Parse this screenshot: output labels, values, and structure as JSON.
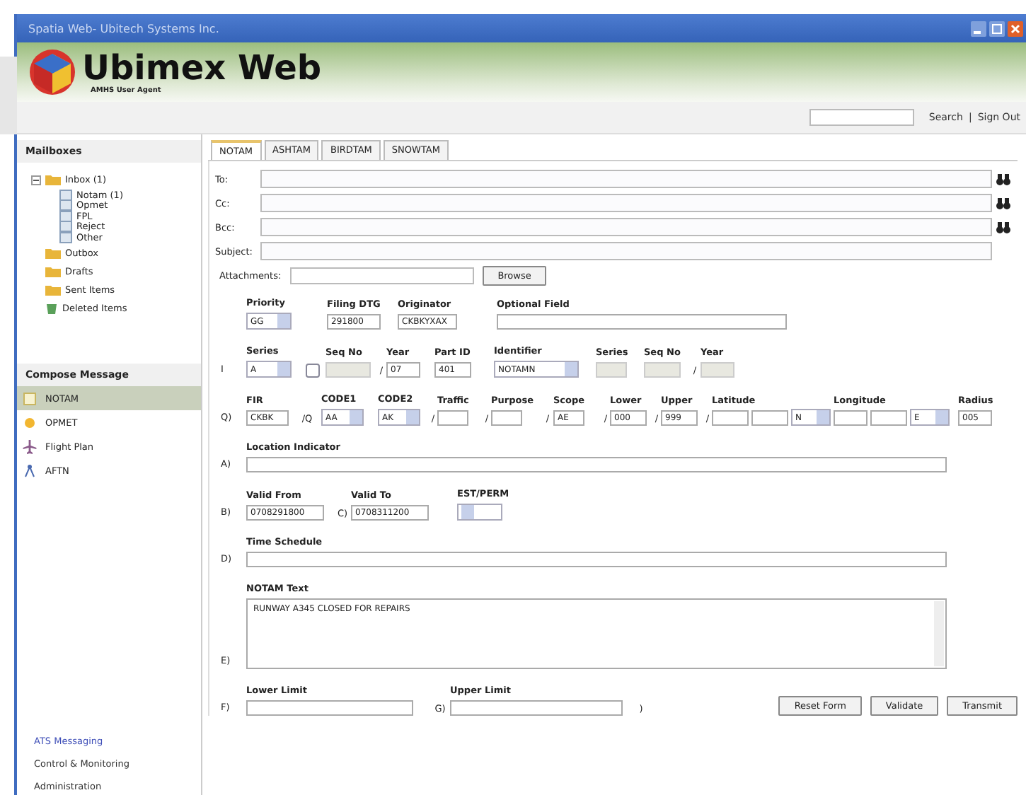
{
  "window": {
    "title": "Spatia Web- Ubitech Systems Inc."
  },
  "header": {
    "title": "Ubimex Web",
    "subtitle": "AMHS User Agent"
  },
  "top_links": [
    "Search",
    "|",
    "Sign Out"
  ],
  "sidebar": {
    "mailboxes_title": "Mailboxes",
    "tree": [
      {
        "label": "Inbox (1)",
        "kind": "folder",
        "expanded": true,
        "children": [
          {
            "label": "Notam (1)",
            "kind": "subfolder"
          },
          {
            "label": "Opmet",
            "kind": "subfolder"
          },
          {
            "label": "FPL",
            "kind": "subfolder"
          },
          {
            "label": "Reject",
            "kind": "subfolder"
          },
          {
            "label": "Other",
            "kind": "subfolder"
          }
        ]
      },
      {
        "label": "Outbox",
        "kind": "folder"
      },
      {
        "label": "Drafts",
        "kind": "folder"
      },
      {
        "label": "Sent Items",
        "kind": "folder"
      },
      {
        "label": "Deleted Items",
        "kind": "trash"
      }
    ],
    "compose_title": "Compose Message",
    "compose": [
      {
        "label": "NOTAM",
        "kind": "notam",
        "selected": true
      },
      {
        "label": "OPMET",
        "kind": "opmet",
        "selected": false
      },
      {
        "label": "Flight Plan",
        "kind": "plane",
        "selected": false
      },
      {
        "label": "AFTN",
        "kind": "aftn",
        "selected": false
      }
    ],
    "nav": [
      {
        "label": "ATS Messaging",
        "selected": true
      },
      {
        "label": "Control & Monitoring",
        "selected": false
      },
      {
        "label": "Administration",
        "selected": false
      }
    ]
  },
  "tabs": [
    {
      "label": "NOTAM",
      "selected": true
    },
    {
      "label": "ASHTAM",
      "selected": false
    },
    {
      "label": "BIRDTAM",
      "selected": false
    },
    {
      "label": "SNOWTAM",
      "selected": false
    }
  ],
  "address": [
    {
      "label": "To:",
      "lookup": true
    },
    {
      "label": "Cc:",
      "lookup": true
    },
    {
      "label": "Bcc:",
      "lookup": true
    },
    {
      "label": "Subject:",
      "lookup": false
    }
  ],
  "attachments": {
    "label": "Attachments:",
    "button": "Browse"
  },
  "rows": [
    {
      "items": [
        {
          "kind": "select",
          "label": "Priority",
          "value": "GG"
        },
        {
          "kind": "text",
          "label": "Filing DTG",
          "value": "291800",
          "disabled": false
        },
        {
          "kind": "text",
          "label": "Originator",
          "value": "CKBKYXAX",
          "disabled": false
        },
        {
          "kind": "text",
          "label": "Optional Field",
          "disabled": false
        }
      ]
    },
    {
      "prefix": "I",
      "items": [
        {
          "kind": "select",
          "label": "Series",
          "value": "A"
        },
        {
          "kind": "checkbox",
          "checked": false
        },
        {
          "kind": "text",
          "label": "Seq No",
          "disabled": true
        },
        {
          "kind": "sep",
          "text": "/"
        },
        {
          "kind": "text",
          "label": "Year",
          "value": "07",
          "disabled": false
        },
        {
          "kind": "text",
          "label": "Part ID",
          "value": "401",
          "disabled": false
        },
        {
          "kind": "select",
          "label": "Identifier",
          "value": "NOTAMN"
        },
        {
          "kind": "text",
          "label": "Series",
          "disabled": true
        },
        {
          "kind": "text",
          "label": "Seq No",
          "disabled": true
        },
        {
          "kind": "sep",
          "text": "/"
        },
        {
          "kind": "text",
          "label": "Year",
          "disabled": true
        }
      ]
    },
    {
      "prefix": "Q)",
      "items": [
        {
          "kind": "text",
          "label": "FIR",
          "value": "CKBK",
          "disabled": false
        },
        {
          "kind": "sep",
          "text": "/Q"
        },
        {
          "kind": "select",
          "label": "CODE1",
          "value": "AA"
        },
        {
          "kind": "select",
          "label": "CODE2",
          "value": "AK"
        },
        {
          "kind": "sep",
          "text": "/"
        },
        {
          "kind": "text",
          "label": "Traffic",
          "disabled": false
        },
        {
          "kind": "sep",
          "text": "/"
        },
        {
          "kind": "text",
          "label": "Purpose",
          "disabled": false
        },
        {
          "kind": "sep",
          "text": "/"
        },
        {
          "kind": "text",
          "label": "Scope",
          "value": "AE",
          "disabled": false
        },
        {
          "kind": "sep",
          "text": "/"
        },
        {
          "kind": "text",
          "label": "Lower",
          "value": "000",
          "disabled": false
        },
        {
          "kind": "sep",
          "text": "/"
        },
        {
          "kind": "text",
          "label": "Upper",
          "value": "999",
          "disabled": false
        },
        {
          "kind": "sep",
          "text": "/"
        },
        {
          "kind": "text",
          "label": "Latitude",
          "disabled": false
        },
        {
          "kind": "text",
          "disabled": false
        },
        {
          "kind": "select",
          "value": "N"
        },
        {
          "kind": "text",
          "label": "Longitude",
          "disabled": false
        },
        {
          "kind": "text",
          "disabled": false
        },
        {
          "kind": "select",
          "value": "E"
        },
        {
          "kind": "text",
          "label": "Radius",
          "value": "005",
          "disabled": false
        }
      ]
    },
    {
      "prefix": "A)",
      "items": [
        {
          "kind": "text",
          "label": "Location Indicator",
          "disabled": false
        }
      ]
    },
    {
      "prefix": "B)",
      "items": [
        {
          "kind": "text",
          "label": "Valid From",
          "value": "0708291800",
          "disabled": false
        },
        {
          "kind": "prefix",
          "text": "C)"
        },
        {
          "kind": "text",
          "label": "Valid To",
          "value": "0708311200",
          "disabled": false
        },
        {
          "kind": "select",
          "label": "EST/PERM"
        }
      ]
    },
    {
      "prefix": "D)",
      "items": [
        {
          "kind": "text",
          "label": "Time Schedule",
          "disabled": false
        }
      ]
    },
    {
      "prefix": "E)",
      "items": [
        {
          "kind": "textarea",
          "label": "NOTAM Text",
          "value": "RUNWAY A345 CLOSED FOR REPAIRS"
        }
      ]
    },
    {
      "prefix": "F)",
      "items": [
        {
          "kind": "text",
          "label": "Lower Limit",
          "disabled": false
        },
        {
          "kind": "prefix",
          "text": "G)"
        },
        {
          "kind": "text",
          "label": "Upper Limit",
          "disabled": false
        },
        {
          "kind": "sep",
          "text": ")"
        }
      ]
    }
  ],
  "actions": [
    "Reset Form",
    "Validate",
    "Transmit"
  ]
}
